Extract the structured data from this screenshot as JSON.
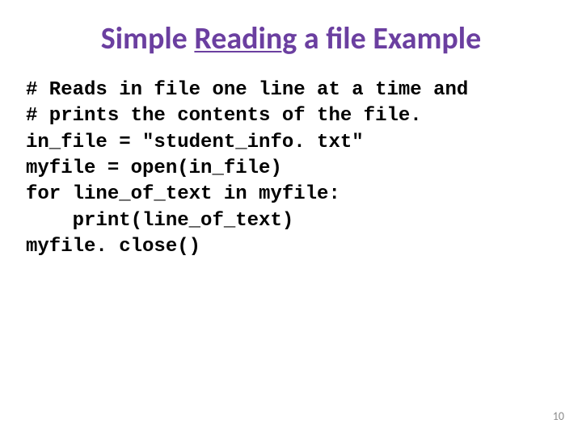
{
  "title_pre": "Simple ",
  "title_underlined": "Reading",
  "title_post": " a file Example",
  "code": {
    "l1": "# Reads in file one line at a time and",
    "l2": "# prints the contents of the file.",
    "l3": "in_file = \"student_info. txt\"",
    "l4": "myfile = open(in_file)",
    "l5": "for line_of_text in myfile:",
    "l6": "    print(line_of_text)",
    "l7": "myfile. close()"
  },
  "page_number": "10"
}
